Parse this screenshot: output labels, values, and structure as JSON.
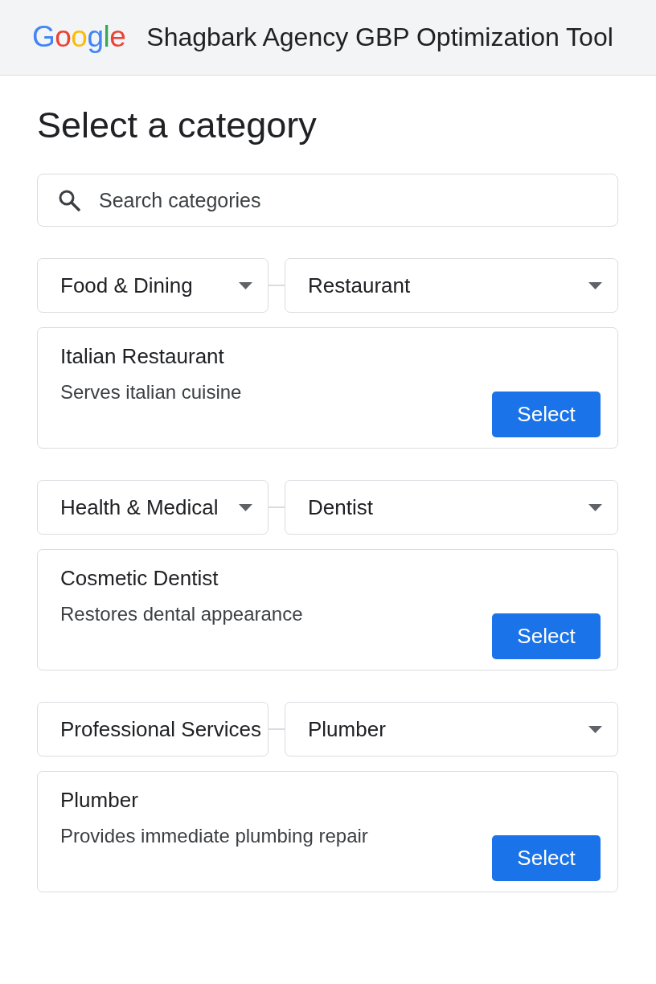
{
  "header": {
    "logo": "Google",
    "title": "Shagbark Agency GBP Optimization Tool"
  },
  "page_title": "Select a category",
  "search": {
    "placeholder": "Search categories"
  },
  "groups": [
    {
      "category": {
        "value": "Food & Dining",
        "arrow": true
      },
      "subcategory": {
        "value": "Restaurant",
        "arrow": true
      },
      "result": {
        "title": "Italian Restaurant",
        "description": "Serves italian cuisine",
        "button": "Select"
      }
    },
    {
      "category": {
        "value": "Health & Medical",
        "arrow": true
      },
      "subcategory": {
        "value": "Dentist",
        "arrow": true
      },
      "result": {
        "title": "Cosmetic Dentist",
        "description": "Restores dental appearance",
        "button": "Select"
      }
    },
    {
      "category": {
        "value": "Professional Services",
        "arrow": false
      },
      "subcategory": {
        "value": "Plumber",
        "arrow": true
      },
      "result": {
        "title": "Plumber",
        "description": "Provides immediate plumbing repair",
        "button": "Select"
      }
    }
  ]
}
